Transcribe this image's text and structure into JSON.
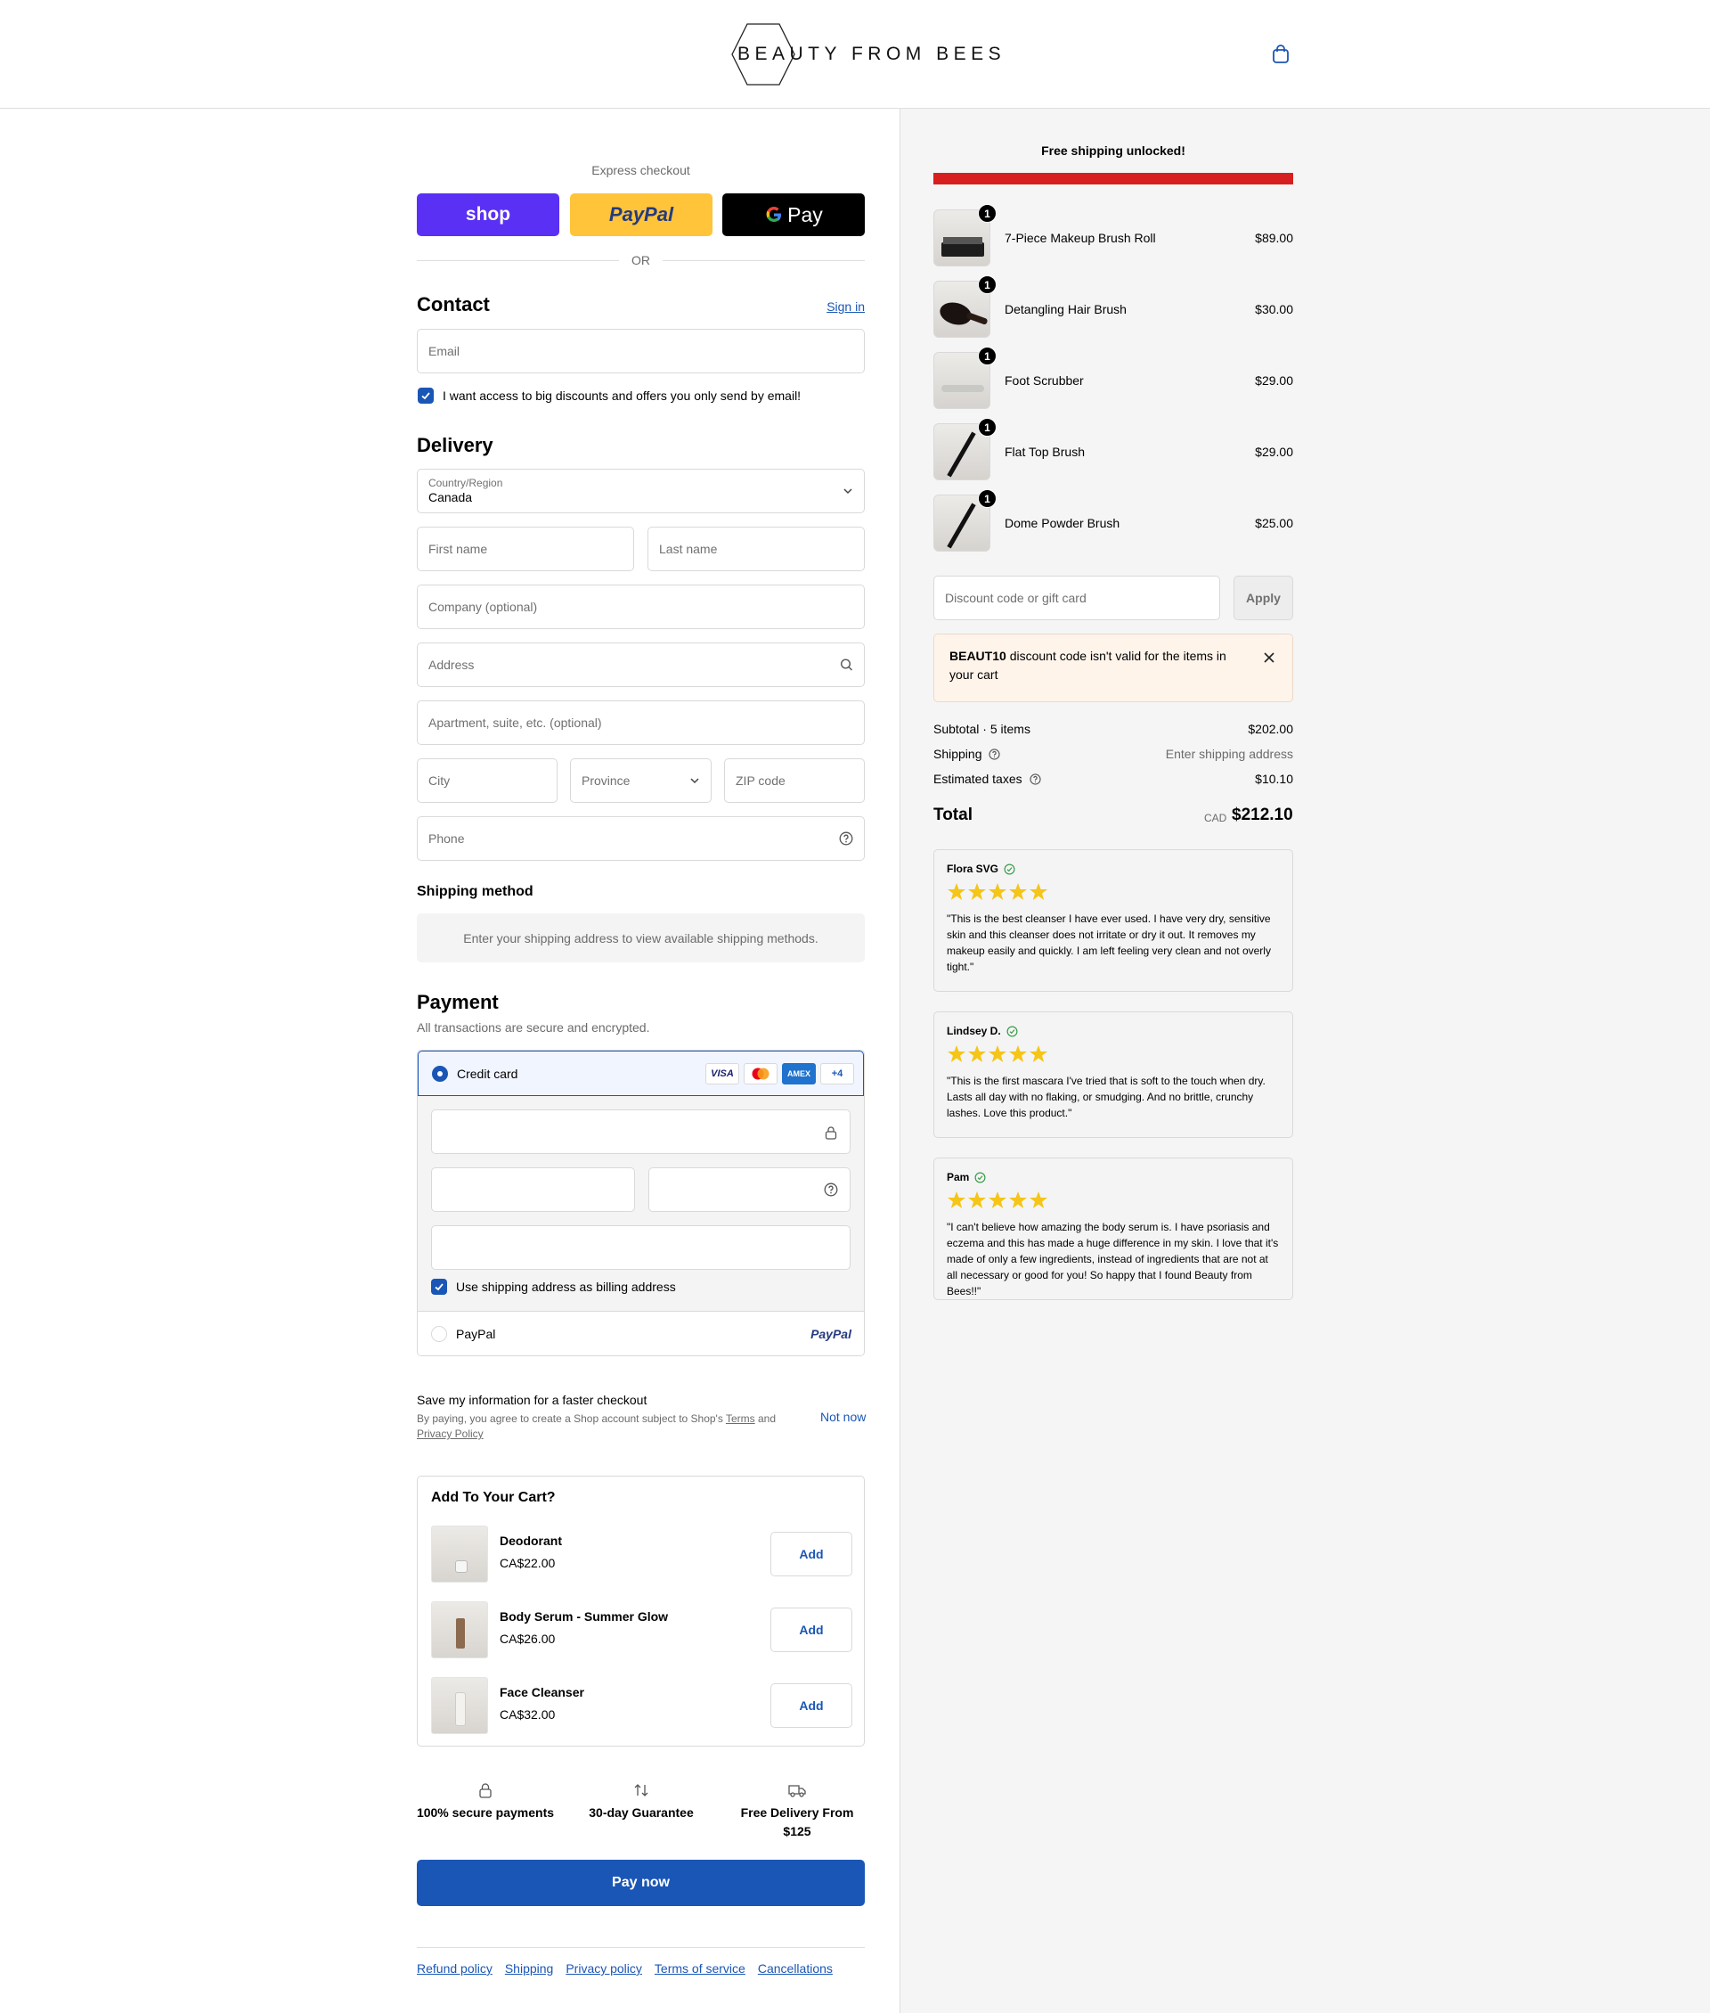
{
  "header": {
    "logo_text": "BEAUTY FROM BEES",
    "cart_icon": "shopping-bag-icon"
  },
  "express": {
    "title": "Express checkout",
    "shop_label": "shop",
    "paypal_label": "PayPal",
    "gpay_label": "Pay",
    "or_label": "OR"
  },
  "contact": {
    "heading": "Contact",
    "sign_in": "Sign in",
    "email_placeholder": "Email",
    "marketing_label": "I want access to big discounts and offers you only send by email!",
    "marketing_checked": true
  },
  "delivery": {
    "heading": "Delivery",
    "country_label": "Country/Region",
    "country_value": "Canada",
    "first_name": "First name",
    "last_name": "Last name",
    "company": "Company (optional)",
    "address": "Address",
    "apartment": "Apartment, suite, etc. (optional)",
    "city": "City",
    "province": "Province",
    "zip": "ZIP code",
    "phone": "Phone"
  },
  "shipping_method": {
    "heading": "Shipping method",
    "message": "Enter your shipping address to view available shipping methods."
  },
  "payment": {
    "heading": "Payment",
    "subtitle": "All transactions are secure and encrypted.",
    "credit_card_label": "Credit card",
    "card_brands": [
      "VISA",
      "mastercard",
      "AMEX",
      "+4"
    ],
    "billing_label": "Use shipping address as billing address",
    "billing_checked": true,
    "paypal_option_label": "PayPal",
    "paypal_logo": "PayPal"
  },
  "save_info": {
    "title": "Save my information for a faster checkout",
    "sub_prefix": "By paying, you agree to create a Shop account subject to Shop's",
    "terms": "Terms",
    "and": "and",
    "privacy": "Privacy Policy",
    "not_now": "Not now"
  },
  "upsell": {
    "title": "Add To Your Cart?",
    "add_label": "Add",
    "items": [
      {
        "name": "Deodorant",
        "price": "CA$22.00"
      },
      {
        "name": "Body Serum - Summer Glow",
        "price": "CA$26.00"
      },
      {
        "name": "Face Cleanser",
        "price": "CA$32.00"
      }
    ]
  },
  "trust": [
    {
      "label": "100% secure payments",
      "icon": "lock-icon"
    },
    {
      "label": "30-day Guarantee",
      "icon": "swap-arrows-icon"
    },
    {
      "label": "Free Delivery From $125",
      "icon": "delivery-truck-icon"
    }
  ],
  "pay_now": "Pay now",
  "footer": {
    "links": [
      "Refund policy",
      "Shipping",
      "Privacy policy",
      "Terms of service",
      "Cancellations"
    ]
  },
  "summary": {
    "free_shipping": "Free shipping unlocked!",
    "progress": 1.0,
    "progress_color": "#d71f1f",
    "items": [
      {
        "qty": "1",
        "name": "7-Piece Makeup Brush Roll",
        "price": "$89.00"
      },
      {
        "qty": "1",
        "name": "Detangling Hair Brush",
        "price": "$30.00"
      },
      {
        "qty": "1",
        "name": "Foot Scrubber",
        "price": "$29.00"
      },
      {
        "qty": "1",
        "name": "Flat Top Brush",
        "price": "$29.00"
      },
      {
        "qty": "1",
        "name": "Dome Powder Brush",
        "price": "$25.00"
      }
    ],
    "discount_placeholder": "Discount code or gift card",
    "apply_label": "Apply",
    "alert_code": "BEAUT10",
    "alert_text": "discount code isn't valid for the items in your cart",
    "subtotal_label": "Subtotal · 5 items",
    "subtotal_value": "$202.00",
    "shipping_label": "Shipping",
    "shipping_value": "Enter shipping address",
    "taxes_label": "Estimated taxes",
    "taxes_value": "$10.10",
    "total_label": "Total",
    "total_currency": "CAD",
    "total_value": "$212.10"
  },
  "reviews": [
    {
      "name": "Flora SVG",
      "stars": 5,
      "text": "\"This is the best cleanser I have ever used. I have very dry, sensitive skin and this cleanser does not irritate or dry it out. It removes my makeup easily and quickly. I am left feeling very clean and not overly tight.\""
    },
    {
      "name": "Lindsey D.",
      "stars": 5,
      "text": "\"This is the first mascara I've tried that is soft to the touch when dry. Lasts all day with no flaking, or smudging. And no brittle, crunchy lashes. Love this product.\""
    },
    {
      "name": "Pam",
      "stars": 5,
      "text": "\"I can't believe how amazing the body serum is. I have psoriasis and eczema and this has made a huge difference in my skin. I love that it's made of only a few ingredients, instead of ingredients that are not at all necessary or good for you! So happy that I found Beauty from Bees!!\""
    }
  ],
  "colors": {
    "accent": "#1a56b5",
    "shop_pay": "#5a31f4",
    "paypal": "#ffc439",
    "star": "#f5c518"
  }
}
